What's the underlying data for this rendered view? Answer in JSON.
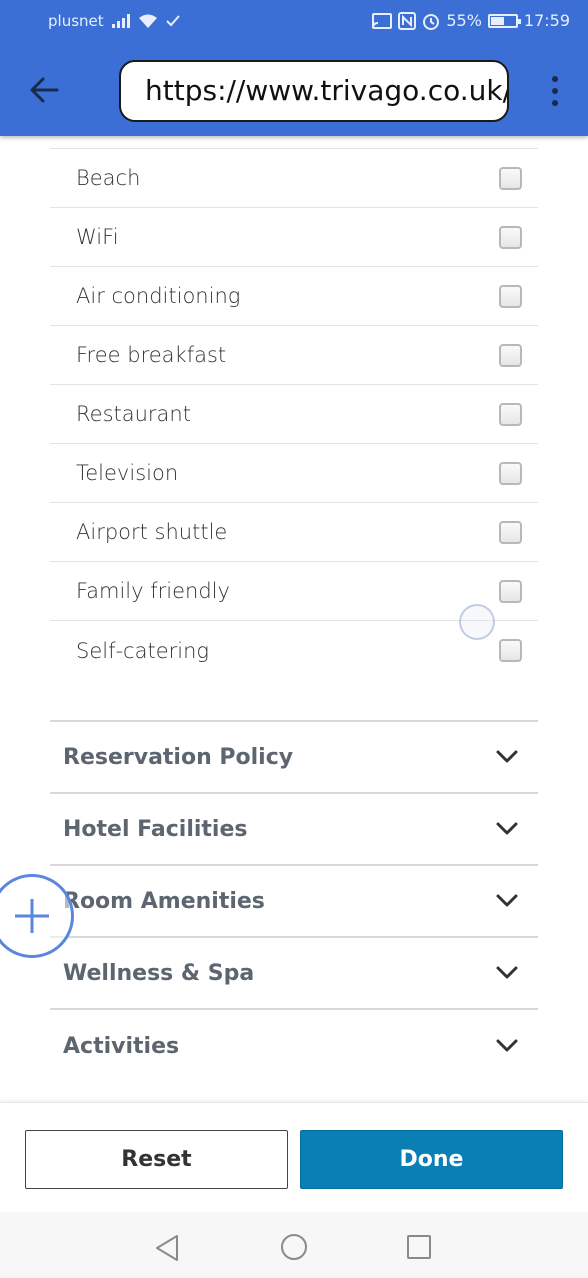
{
  "status_bar": {
    "carrier": "plusnet",
    "battery": "55%",
    "battery_level": 0.55,
    "time": "17:59"
  },
  "browser": {
    "url": "https://www.trivago.co.uk/?"
  },
  "amenities": [
    {
      "label": "Beach",
      "checked": false
    },
    {
      "label": "WiFi",
      "checked": false
    },
    {
      "label": "Air conditioning",
      "checked": false
    },
    {
      "label": "Free breakfast",
      "checked": false
    },
    {
      "label": "Restaurant",
      "checked": false
    },
    {
      "label": "Television",
      "checked": false
    },
    {
      "label": "Airport shuttle",
      "checked": false
    },
    {
      "label": "Family friendly",
      "checked": false
    },
    {
      "label": "Self-catering",
      "checked": false
    }
  ],
  "sections": [
    {
      "label": "Reservation Policy"
    },
    {
      "label": "Hotel Facilities"
    },
    {
      "label": "Room Amenities"
    },
    {
      "label": "Wellness & Spa"
    },
    {
      "label": "Activities"
    }
  ],
  "footer": {
    "reset_label": "Reset",
    "done_label": "Done"
  },
  "icons": {
    "back": "arrow-left-icon",
    "menu": "kebab-menu-icon",
    "expand": "chevron-down-icon",
    "fab": "plus-icon"
  },
  "colors": {
    "header_blue": "#3b6fd6",
    "done_button": "#0a7fb3",
    "section_text": "#5d6670"
  }
}
